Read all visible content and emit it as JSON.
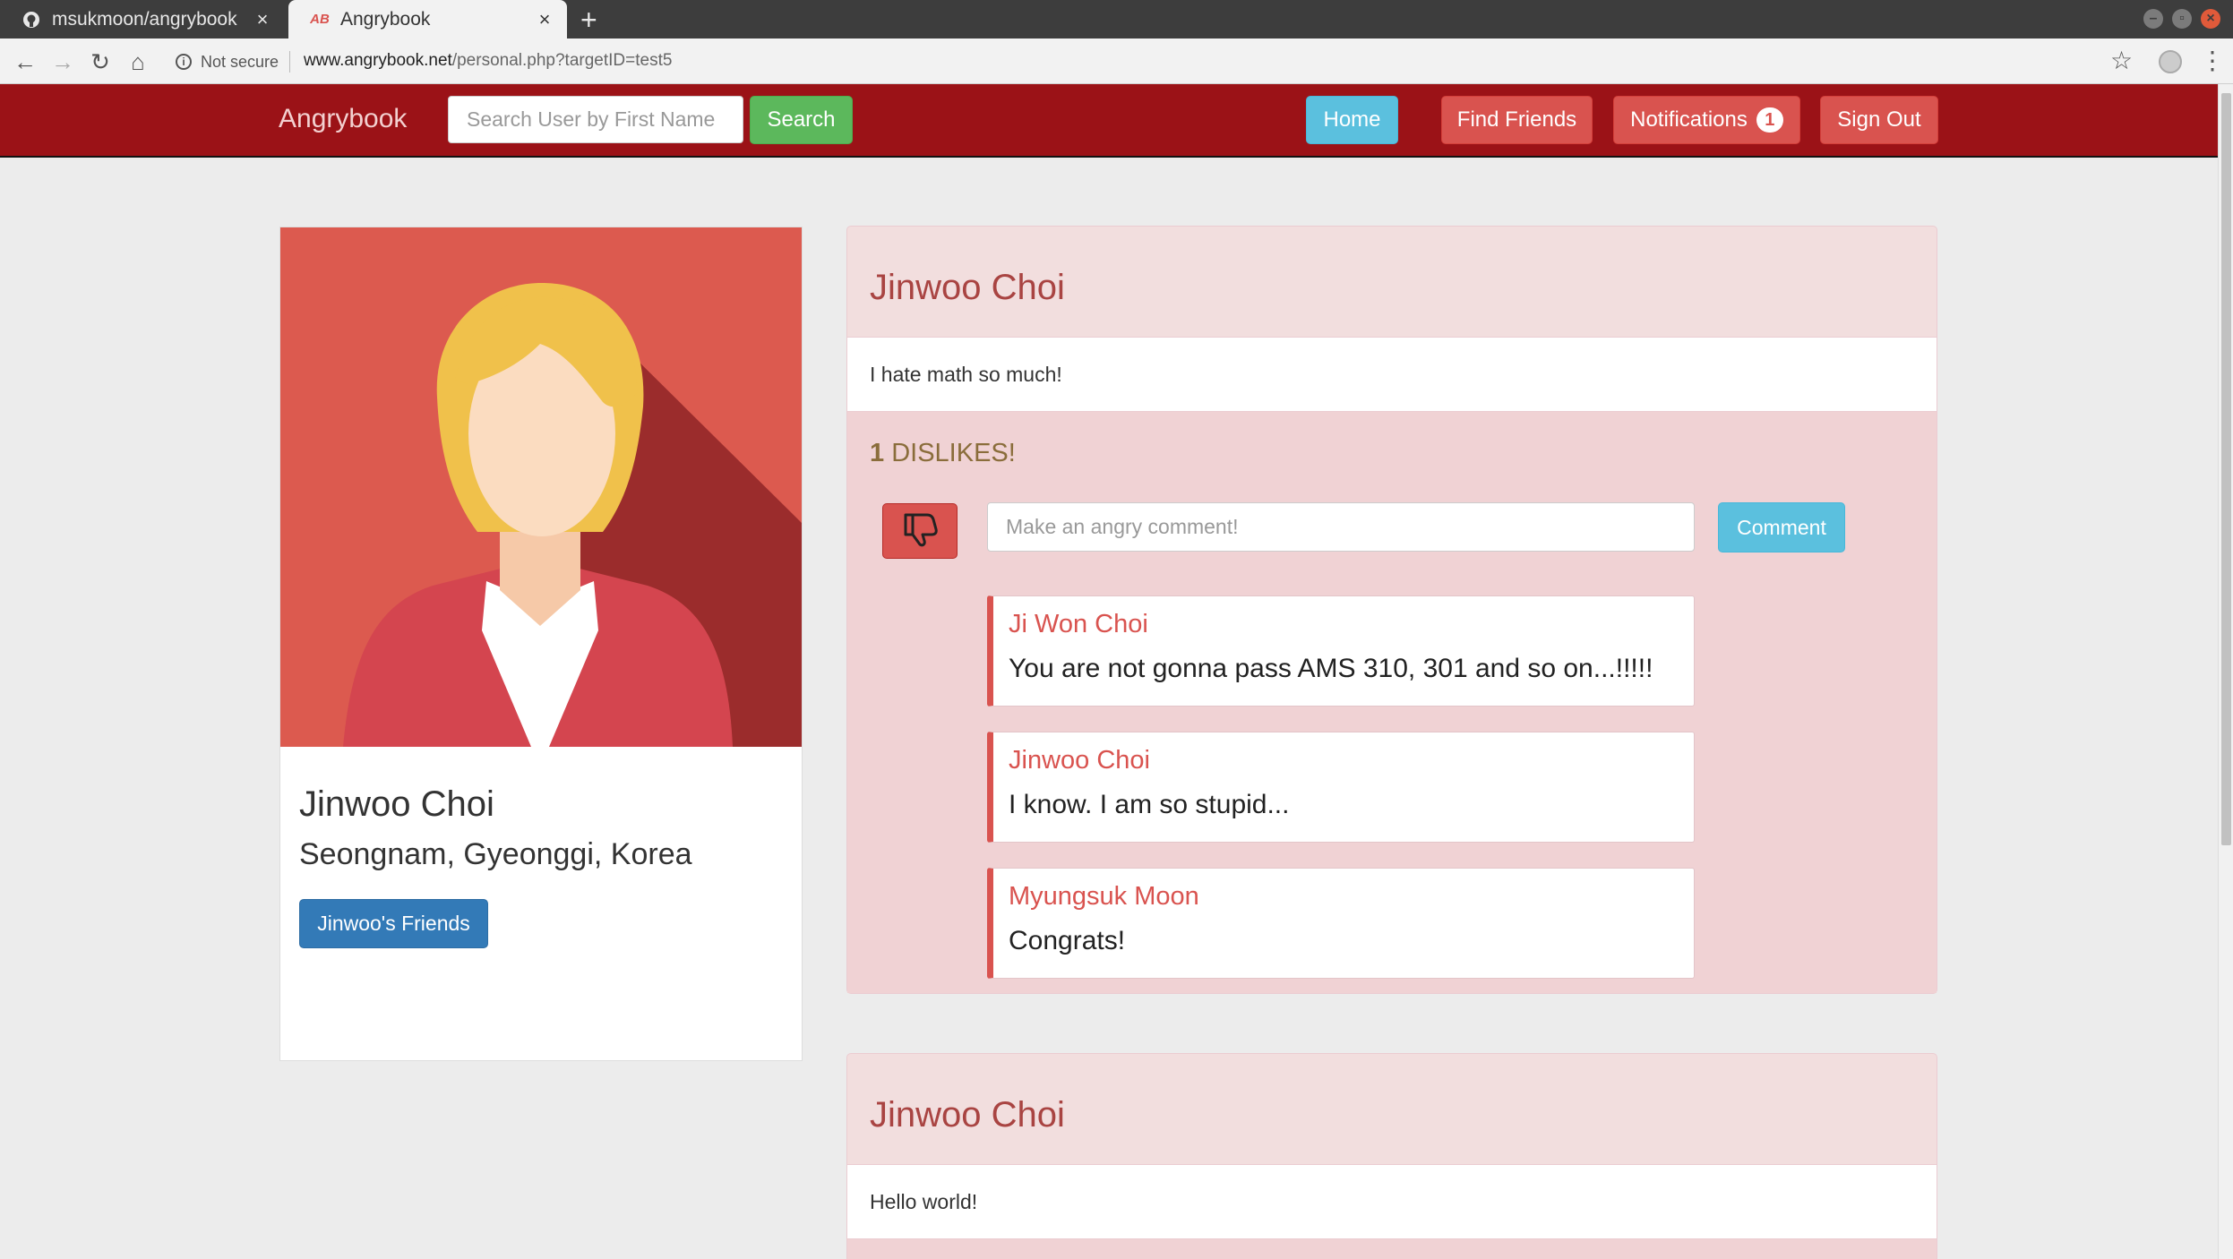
{
  "browser": {
    "tabs": [
      {
        "title": "msukmoon/angrybook",
        "icon": "github-icon"
      },
      {
        "title": "Angrybook",
        "icon": "angrybook-favicon",
        "favicon_text": "AB"
      }
    ],
    "tab_close": "×",
    "new_tab": "+",
    "security_label": "Not secure",
    "url_host": "www.angrybook.net",
    "url_path": "/personal.php?targetID=test5"
  },
  "navbar": {
    "brand": "Angrybook",
    "search_placeholder": "Search User by First Name",
    "search_label": "Search",
    "home_label": "Home",
    "find_friends_label": "Find Friends",
    "notifications_label": "Notifications",
    "notifications_count": "1",
    "sign_out_label": "Sign Out"
  },
  "colors": {
    "navbar": "#9b1217",
    "danger": "#d9534f",
    "info": "#5bc0de",
    "success": "#5cb85c",
    "primary": "#337ab7",
    "panel": "#f2dede"
  },
  "profile": {
    "name": "Jinwoo Choi",
    "location": "Seongnam, Gyeonggi, Korea",
    "friends_button": "Jinwoo's Friends"
  },
  "posts": [
    {
      "author": "Jinwoo Choi",
      "text": "I hate math so much!",
      "dislike_count": "1",
      "dislike_label": "DISLIKES!",
      "comment_placeholder": "Make an angry comment!",
      "comment_button": "Comment",
      "comments": [
        {
          "author": "Ji Won Choi",
          "text": "You are not gonna pass AMS 310, 301 and so on...!!!!!"
        },
        {
          "author": "Jinwoo Choi",
          "text": "I know. I am so stupid..."
        },
        {
          "author": "Myungsuk Moon",
          "text": "Congrats!"
        }
      ]
    },
    {
      "author": "Jinwoo Choi",
      "text": "Hello world!"
    }
  ]
}
